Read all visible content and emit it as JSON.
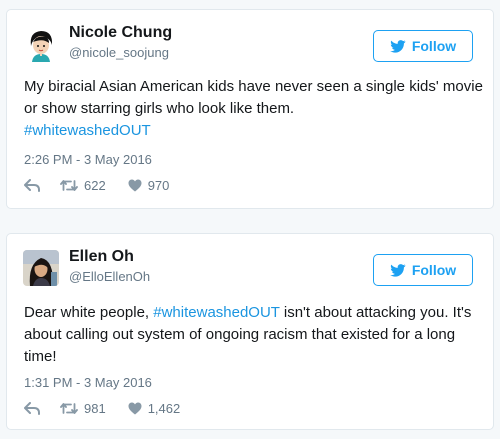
{
  "colors": {
    "accent": "#1da1f2",
    "hashtag": "#1b95e0",
    "muted": "#657786"
  },
  "follow_icon": "twitter-bird-icon",
  "tweets": [
    {
      "name": "Nicole Chung",
      "handle": "@nicole_soojung",
      "follow_label": "Follow",
      "text": "My biracial Asian American kids have never seen a single kids' movie or show starring girls who look like them.",
      "hashtag": "#whitewashedOUT",
      "timestamp": "2:26 PM - 3 May 2016",
      "retweets": "622",
      "likes": "970"
    },
    {
      "name": "Ellen Oh",
      "handle": "@ElloEllenOh",
      "follow_label": "Follow",
      "text_before": "Dear white people, ",
      "hashtag": "#whitewashedOUT",
      "text_after": " isn't about attacking you. It's about calling out system of ongoing racism that existed for a long time!",
      "timestamp": "1:31 PM - 3 May 2016",
      "retweets": "981",
      "likes": "1,462"
    }
  ]
}
